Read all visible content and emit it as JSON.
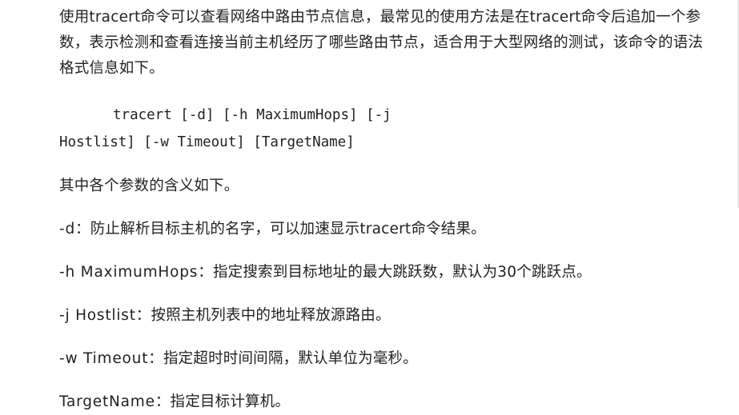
{
  "intro": "使用tracert命令可以查看网络中路由节点信息，最常见的使用方法是在tracert命令后追加一个参数，表示检测和查看连接当前主机经历了哪些路由节点，适合用于大型网络的测试，该命令的语法格式信息如下。",
  "syntax": {
    "line1": "tracert [-d] [-h MaximumHops] [-j",
    "line2": "Hostlist] [-w Timeout] [TargetName]"
  },
  "params_intro": "其中各个参数的含义如下。",
  "params": [
    {
      "name": "-d",
      "desc": "：防止解析目标主机的名字，可以加速显示tracert命令结果。"
    },
    {
      "name": "-h MaximumHops",
      "desc": "：指定搜索到目标地址的最大跳跃数，默认为30个跳跃点。"
    },
    {
      "name": "-j Hostlist",
      "desc": "：按照主机列表中的地址释放源路由。"
    },
    {
      "name": "-w Timeout",
      "desc": "：指定超时时间间隔，默认单位为毫秒。"
    },
    {
      "name": "TargetName",
      "desc": "：指定目标计算机。"
    }
  ]
}
